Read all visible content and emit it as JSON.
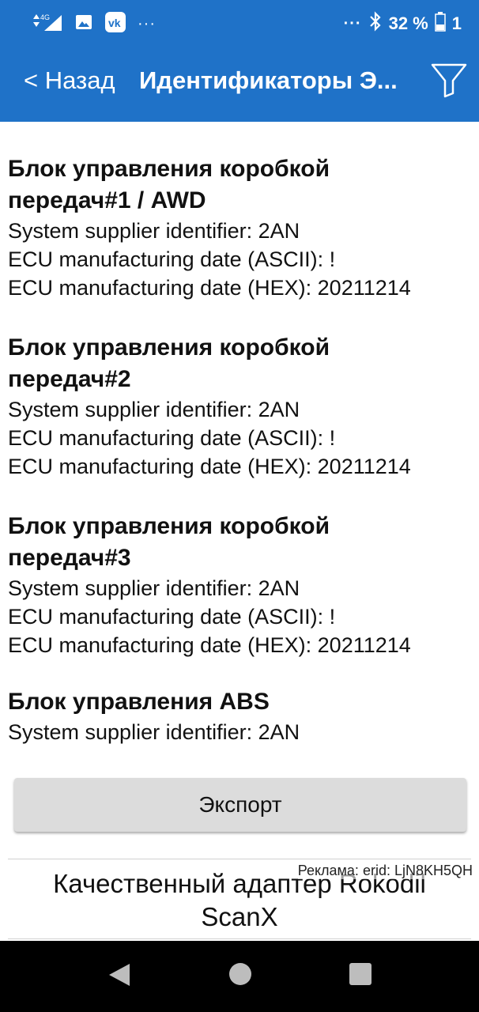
{
  "status_bar": {
    "network": "4G",
    "battery_percent": "32 %",
    "sim": "1",
    "dots": "···"
  },
  "app_bar": {
    "back_label": "< Назад",
    "title": "Идентификаторы Э..."
  },
  "blocks": [
    {
      "title_line1": "Блок управления коробкой",
      "title_line2": "передач#1 / AWD",
      "lines": [
        "System supplier identifier: 2AN",
        "ECU manufacturing date (ASCII): !",
        "ECU manufacturing date (HEX): 20211214"
      ]
    },
    {
      "title_line1": "Блок управления коробкой",
      "title_line2": "передач#2",
      "lines": [
        "System supplier identifier: 2AN",
        "ECU manufacturing date (ASCII): !",
        "ECU manufacturing date (HEX): 20211214"
      ]
    },
    {
      "title_line1": "Блок управления коробкой",
      "title_line2": "передач#3",
      "lines": [
        "System supplier identifier: 2AN",
        "ECU manufacturing date (ASCII): !",
        "ECU manufacturing date (HEX): 20211214"
      ]
    },
    {
      "title_line1": "Блок управления ABS",
      "lines": [
        "System supplier identifier: 2AN"
      ]
    }
  ],
  "export_label": "Экспорт",
  "ad": {
    "label": "Реклама: erid: LjN8KH5QH",
    "text_line1": "Качественный адаптер Rokodil",
    "text_line2": "ScanX"
  },
  "colors": {
    "primary": "#1f72c8",
    "button_bg": "#dcdcdc",
    "navbar": "#000000"
  }
}
